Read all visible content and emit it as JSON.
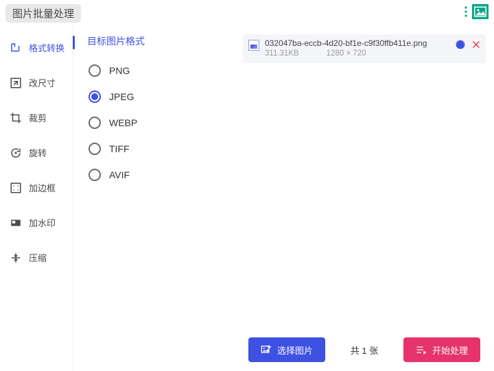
{
  "header": {
    "title": "图片批量处理"
  },
  "sidebar": {
    "items": [
      {
        "label": "格式转换",
        "active": true
      },
      {
        "label": "改尺寸",
        "active": false
      },
      {
        "label": "裁剪",
        "active": false
      },
      {
        "label": "旋转",
        "active": false
      },
      {
        "label": "加边框",
        "active": false
      },
      {
        "label": "加水印",
        "active": false
      },
      {
        "label": "压缩",
        "active": false
      }
    ]
  },
  "options": {
    "title": "目标图片格式",
    "formats": [
      {
        "label": "PNG",
        "selected": false
      },
      {
        "label": "JPEG",
        "selected": true
      },
      {
        "label": "WEBP",
        "selected": false
      },
      {
        "label": "TIFF",
        "selected": false
      },
      {
        "label": "AVIF",
        "selected": false
      }
    ]
  },
  "files": {
    "items": [
      {
        "name": "032047ba-eccb-4d20-bf1e-c9f30ffb411e.png",
        "size": "311.31KB",
        "dimensions": "1280 × 720"
      }
    ]
  },
  "footer": {
    "select_label": "选择图片",
    "count_text": "共 1 张",
    "start_label": "开始处理"
  }
}
